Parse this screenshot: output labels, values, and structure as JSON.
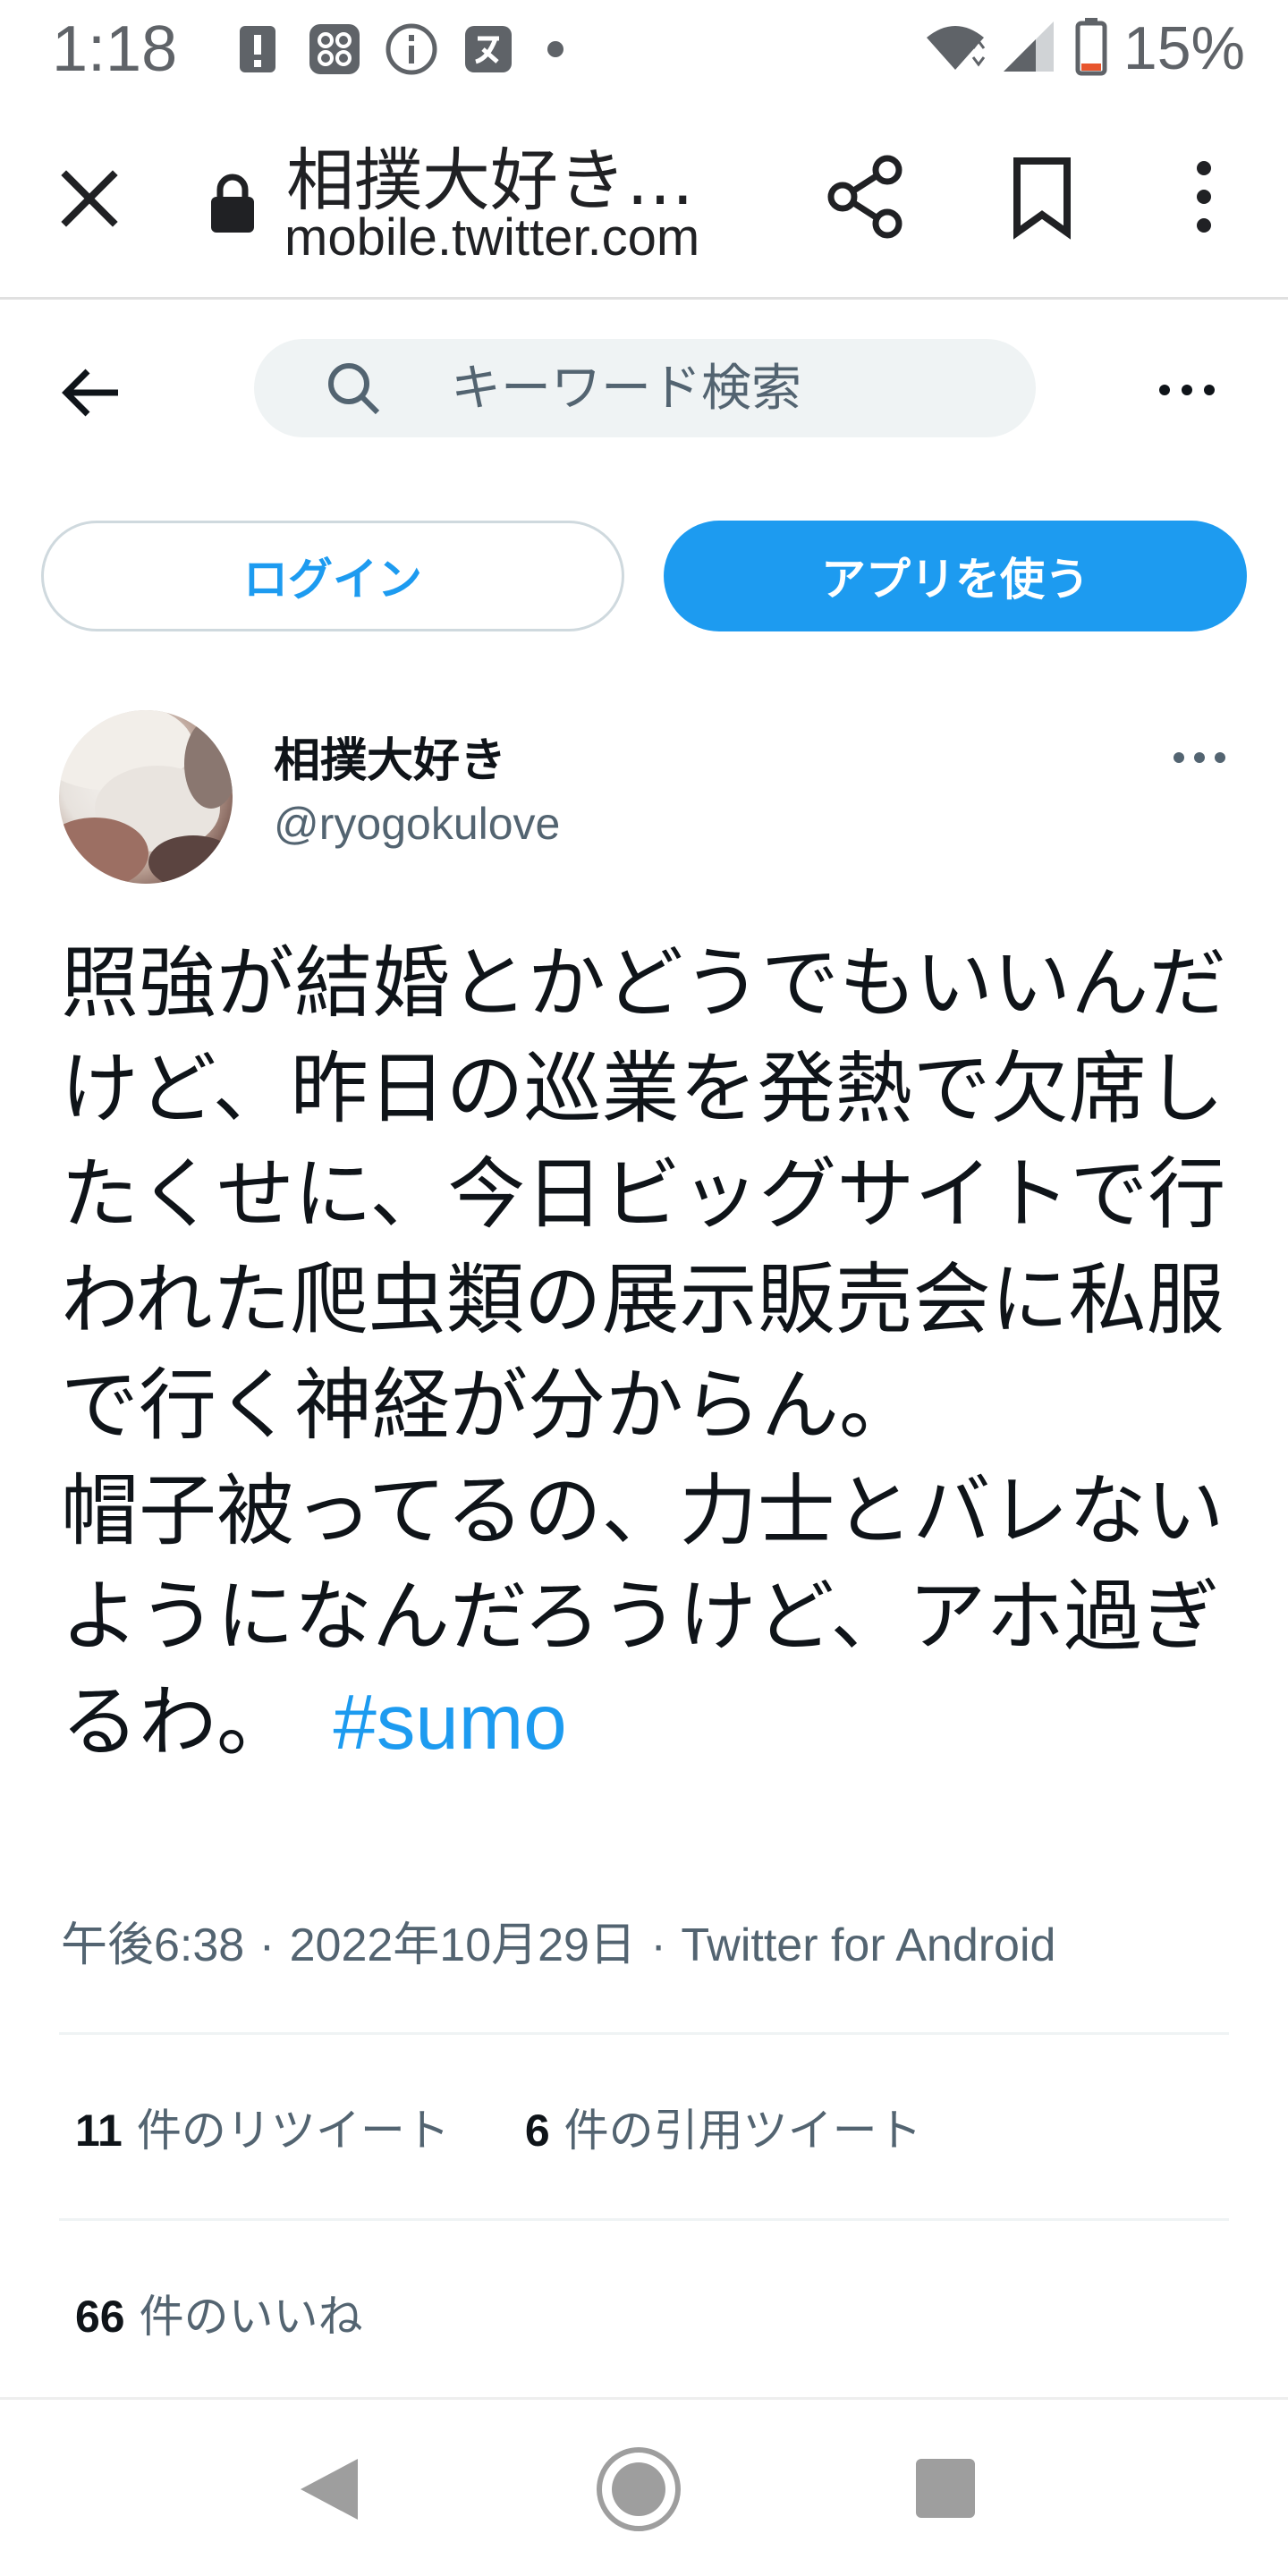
{
  "status_bar": {
    "time": "1:18",
    "battery_percent": "15%",
    "battery_level": 0.15,
    "icons": [
      "alert-icon",
      "apps-icon",
      "info-icon",
      "translate-icon",
      "dot-icon",
      "wifi-icon",
      "signal-icon",
      "battery-icon"
    ]
  },
  "browser": {
    "page_title": "相撲大好き…",
    "url": "mobile.twitter.com"
  },
  "header": {
    "search_placeholder": "キーワード検索"
  },
  "buttons": {
    "login": "ログイン",
    "use_app": "アプリを使う"
  },
  "tweet": {
    "author_name": "相撲大好き",
    "author_handle": "@ryogokulove",
    "text": "照強が結婚とかどうでもいいんだけど、昨日の巡業を発熱で欠席したくせに、今日ビッグサイトで行われた爬虫類の展示販売会に私服で行く神経が分からん。\n帽子被ってるの、力士とバレないようになんだろうけど、アホ過ぎるわ。",
    "hashtag": "#sumo",
    "time": "午後6:38",
    "date": "2022年10月29日",
    "source": "Twitter for Android",
    "separator": "·",
    "retweets_count": "11",
    "retweets_label": "件のリツイート",
    "quotes_count": "6",
    "quotes_label": "件の引用ツイート",
    "likes_count": "66",
    "likes_label": "件のいいね"
  },
  "colors": {
    "twitter_blue": "#1d9bf0",
    "secondary_text": "#536471",
    "search_bg": "#eff3f4",
    "battery_low": "#e8552d"
  }
}
